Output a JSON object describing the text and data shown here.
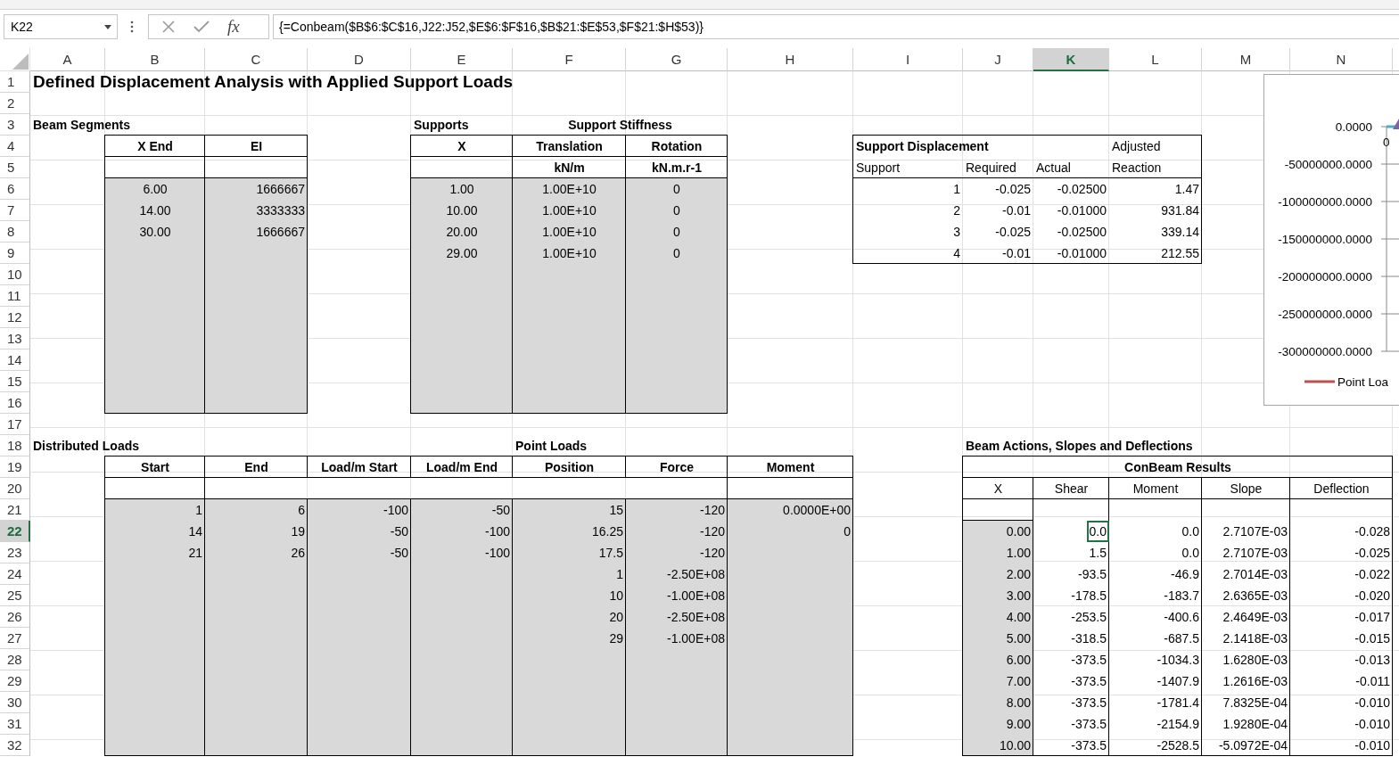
{
  "name_box": "K22",
  "formula_bar": {
    "fx_label": "fx",
    "formula": "{=Conbeam($B$6:$C$16,J22:J52,$E$6:$F$16,$B$21:$E$53,$F$21:$H$53)}"
  },
  "columns": [
    {
      "label": "A",
      "selected": false
    },
    {
      "label": "B",
      "selected": false
    },
    {
      "label": "C",
      "selected": false
    },
    {
      "label": "D",
      "selected": false
    },
    {
      "label": "E",
      "selected": false
    },
    {
      "label": "F",
      "selected": false
    },
    {
      "label": "G",
      "selected": false
    },
    {
      "label": "H",
      "selected": false
    },
    {
      "label": "I",
      "selected": false
    },
    {
      "label": "J",
      "selected": false
    },
    {
      "label": "K",
      "selected": true
    },
    {
      "label": "L",
      "selected": false
    },
    {
      "label": "M",
      "selected": false
    },
    {
      "label": "N",
      "selected": false
    }
  ],
  "rows": [
    {
      "label": "1",
      "selected": false
    },
    {
      "label": "2",
      "selected": false
    },
    {
      "label": "3",
      "selected": false
    },
    {
      "label": "4",
      "selected": false
    },
    {
      "label": "5",
      "selected": false
    },
    {
      "label": "6",
      "selected": false
    },
    {
      "label": "7",
      "selected": false
    },
    {
      "label": "8",
      "selected": false
    },
    {
      "label": "9",
      "selected": false
    },
    {
      "label": "10",
      "selected": false
    },
    {
      "label": "11",
      "selected": false
    },
    {
      "label": "12",
      "selected": false
    },
    {
      "label": "13",
      "selected": false
    },
    {
      "label": "14",
      "selected": false
    },
    {
      "label": "15",
      "selected": false
    },
    {
      "label": "16",
      "selected": false
    },
    {
      "label": "17",
      "selected": false
    },
    {
      "label": "18",
      "selected": false
    },
    {
      "label": "19",
      "selected": false
    },
    {
      "label": "20",
      "selected": false
    },
    {
      "label": "21",
      "selected": false
    },
    {
      "label": "22",
      "selected": true
    },
    {
      "label": "23",
      "selected": false
    },
    {
      "label": "24",
      "selected": false
    },
    {
      "label": "25",
      "selected": false
    },
    {
      "label": "26",
      "selected": false
    },
    {
      "label": "27",
      "selected": false
    },
    {
      "label": "28",
      "selected": false
    },
    {
      "label": "29",
      "selected": false
    },
    {
      "label": "30",
      "selected": false
    },
    {
      "label": "31",
      "selected": false
    },
    {
      "label": "32",
      "selected": false
    }
  ],
  "title": "Defined Displacement Analysis with Applied Support Loads",
  "beam_segments": {
    "title": "Beam Segments",
    "columns": [
      "X End",
      "EI"
    ],
    "rows": [
      [
        "6.00",
        "1666667"
      ],
      [
        "14.00",
        "3333333"
      ],
      [
        "30.00",
        "1666667"
      ]
    ]
  },
  "supports": {
    "title": "Supports",
    "group_header": "Support Stiffness",
    "columns": [
      "X",
      "Translation",
      "Rotation"
    ],
    "units": [
      "kN/m",
      "kN.m.r-1"
    ],
    "rows": [
      [
        "1.00",
        "1.00E+10",
        "0"
      ],
      [
        "10.00",
        "1.00E+10",
        "0"
      ],
      [
        "20.00",
        "1.00E+10",
        "0"
      ],
      [
        "29.00",
        "1.00E+10",
        "0"
      ]
    ]
  },
  "support_displacement": {
    "title": "Support Displacement",
    "header_top": "Adjusted",
    "columns": [
      "Support",
      "Required",
      "Actual",
      "Reaction"
    ],
    "rows": [
      [
        "1",
        "-0.025",
        "-0.02500",
        "1.47"
      ],
      [
        "2",
        "-0.01",
        "-0.01000",
        "931.84"
      ],
      [
        "3",
        "-0.025",
        "-0.02500",
        "339.14"
      ],
      [
        "4",
        "-0.01",
        "-0.01000",
        "212.55"
      ]
    ]
  },
  "chart": {
    "y_axis_labels": [
      "0.0000",
      "-50000000.0000",
      "-100000000.0000",
      "-150000000.0000",
      "-200000000.0000",
      "-250000000.0000",
      "-300000000.0000"
    ],
    "x_axis_labels": [
      "0"
    ],
    "legend": [
      "Point Loa"
    ]
  },
  "distributed_loads": {
    "title": "Distributed Loads",
    "columns": [
      "Start",
      "End",
      "Load/m Start",
      "Load/m End"
    ],
    "rows": [
      [
        "1",
        "6",
        "-100",
        "-50"
      ],
      [
        "14",
        "19",
        "-50",
        "-100"
      ],
      [
        "21",
        "26",
        "-50",
        "-100"
      ]
    ]
  },
  "point_loads": {
    "title": "Point Loads",
    "columns": [
      "Position",
      "Force",
      "Moment"
    ],
    "rows": [
      [
        "15",
        "-120",
        "0.0000E+00"
      ],
      [
        "16.25",
        "-120",
        "0"
      ],
      [
        "17.5",
        "-120"
      ],
      [
        "1",
        "-2.50E+08"
      ],
      [
        "10",
        "-1.00E+08"
      ],
      [
        "20",
        "-2.50E+08"
      ],
      [
        "29",
        "-1.00E+08"
      ]
    ]
  },
  "beam_actions": {
    "title": "Beam Actions, Slopes and Deflections",
    "group_header": "ConBeam Results",
    "columns": [
      "X",
      "Shear",
      "Moment",
      "Slope",
      "Deflection"
    ],
    "rows": [
      {
        "cells": [
          "0.00",
          "0.0",
          "0.0",
          "2.7107E-03",
          "-0.028"
        ],
        "selected": true
      },
      {
        "cells": [
          "1.00",
          "1.5",
          "0.0",
          "2.7107E-03",
          "-0.025"
        ],
        "selected": false
      },
      {
        "cells": [
          "2.00",
          "-93.5",
          "-46.9",
          "2.7014E-03",
          "-0.022"
        ],
        "selected": false
      },
      {
        "cells": [
          "3.00",
          "-178.5",
          "-183.7",
          "2.6365E-03",
          "-0.020"
        ],
        "selected": false
      },
      {
        "cells": [
          "4.00",
          "-253.5",
          "-400.6",
          "2.4649E-03",
          "-0.017"
        ],
        "selected": false
      },
      {
        "cells": [
          "5.00",
          "-318.5",
          "-687.5",
          "2.1418E-03",
          "-0.015"
        ],
        "selected": false
      },
      {
        "cells": [
          "6.00",
          "-373.5",
          "-1034.3",
          "1.6280E-03",
          "-0.013"
        ],
        "selected": false
      },
      {
        "cells": [
          "7.00",
          "-373.5",
          "-1407.9",
          "1.2616E-03",
          "-0.011"
        ],
        "selected": false
      },
      {
        "cells": [
          "8.00",
          "-373.5",
          "-1781.4",
          "7.8325E-04",
          "-0.010"
        ],
        "selected": false
      },
      {
        "cells": [
          "9.00",
          "-373.5",
          "-2154.9",
          "1.9280E-04",
          "-0.010"
        ],
        "selected": false
      },
      {
        "cells": [
          "10.00",
          "-373.5",
          "-2528.5",
          "-5.0972E-04",
          "-0.010"
        ],
        "selected": false
      }
    ]
  }
}
